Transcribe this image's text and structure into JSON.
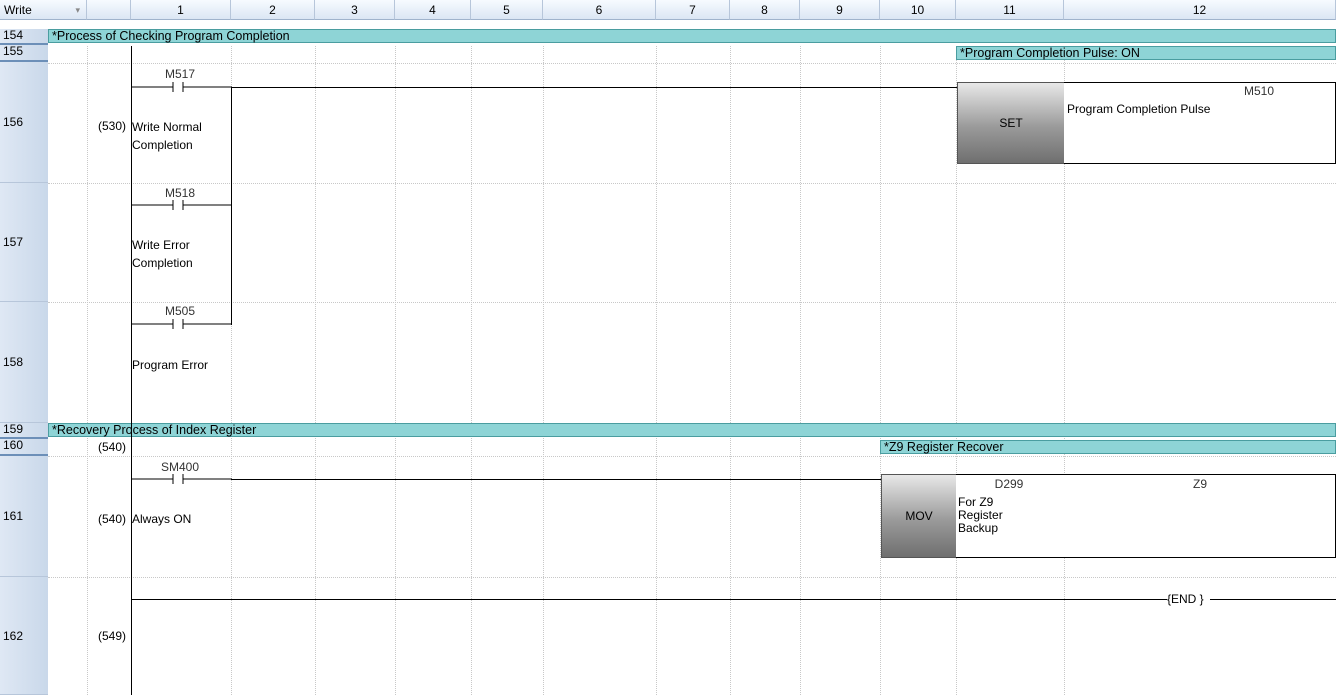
{
  "header": {
    "write_label": "Write",
    "dropdown_glyph": "▾",
    "columns": [
      "1",
      "2",
      "3",
      "4",
      "5",
      "6",
      "7",
      "8",
      "9",
      "10",
      "11",
      "12"
    ]
  },
  "rows": {
    "r154": "154",
    "r155": "155",
    "r156": "156",
    "r157": "157",
    "r158": "158",
    "r159": "159",
    "r160": "160",
    "r161": "161",
    "r162": "162"
  },
  "statements": {
    "s154": "*Process of Checking Program Completion",
    "s155": "*Program Completion Pulse: ON",
    "s159": "*Recovery Process of Index Register",
    "s160": "*Z9 Register Recover"
  },
  "steps": {
    "s156": "(530)",
    "s160": "(540)",
    "s161": "(540)",
    "s162": "(549)"
  },
  "contacts": {
    "c156": {
      "device": "M517",
      "comment_1": "Write Normal",
      "comment_2": "Completion"
    },
    "c157": {
      "device": "M518",
      "comment_1": "Write Error",
      "comment_2": "Completion"
    },
    "c158": {
      "device": "M505",
      "comment_1": "Program Error"
    },
    "c161": {
      "device": "SM400",
      "comment_1": "Always ON"
    }
  },
  "instructions": {
    "set": {
      "name": "SET",
      "operand": "M510",
      "operand_comment": "Program Completion Pulse"
    },
    "mov": {
      "name": "MOV",
      "src": "D299",
      "src_comment_1": "For Z9",
      "src_comment_2": "Register",
      "src_comment_3": "Backup",
      "dst": "Z9"
    },
    "end": "{END }"
  },
  "colors": {
    "statement_bg": "#8ed4d6",
    "header_bg": "#dbe6f4"
  }
}
